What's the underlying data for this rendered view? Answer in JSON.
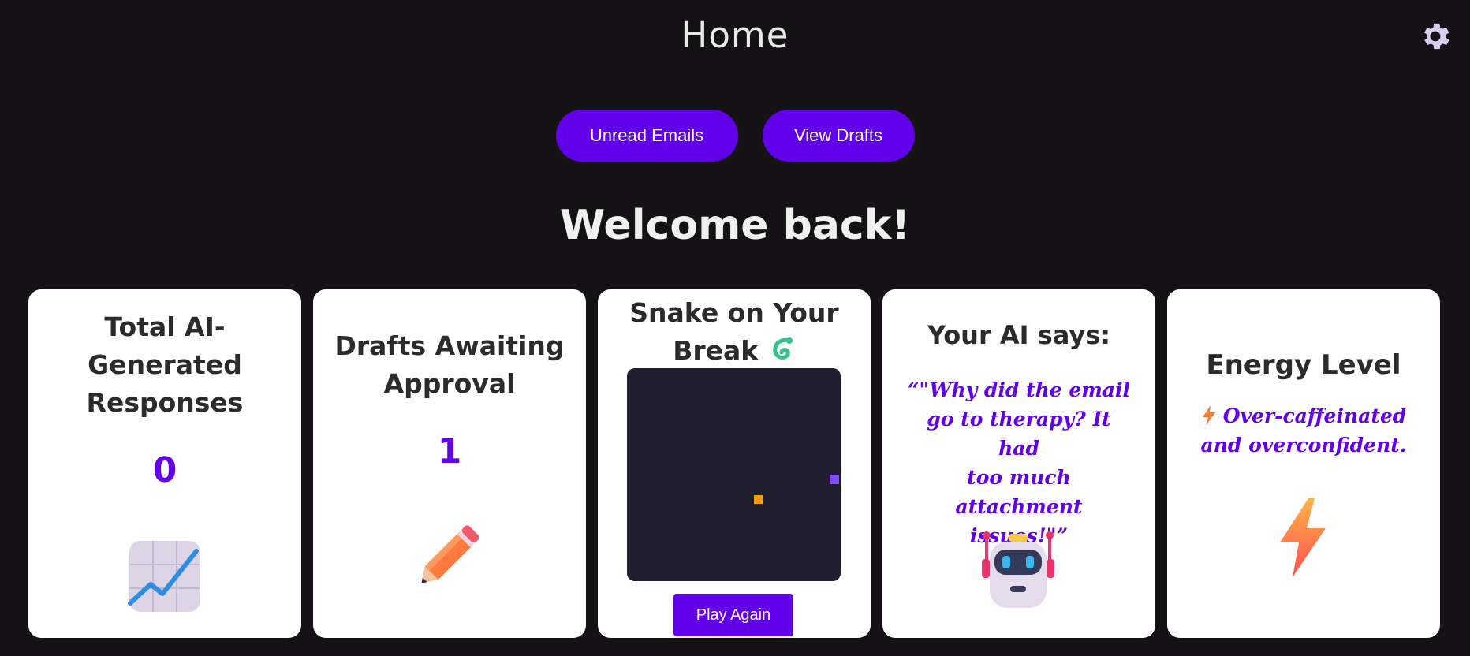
{
  "header": {
    "title": "Home"
  },
  "icons": {
    "settings": "gear-icon"
  },
  "nav": {
    "unread_label": "Unread Emails",
    "drafts_label": "View Drafts"
  },
  "welcome": "Welcome back!",
  "cards": {
    "total": {
      "title_lines": [
        "Total AI-",
        "Generated",
        "Responses"
      ],
      "value": "0",
      "icon": "chart-increasing-icon"
    },
    "drafts": {
      "title_lines": [
        "Drafts Awaiting",
        "Approval"
      ],
      "value": "1",
      "icon": "pencil-icon"
    },
    "snake": {
      "title_lines": [
        "Snake on Your",
        "Break"
      ],
      "icon": "snake-icon",
      "play_label": "Play Again"
    },
    "ai": {
      "title": "Your AI says:",
      "quote_lines": [
        "“\"Why did the email",
        "go to therapy? It had",
        "too much attachment",
        "issues!\"”"
      ],
      "icon": "robot-icon"
    },
    "energy": {
      "title": "Energy Level",
      "status_lines": [
        "Over-caffeinated",
        "and overconfident."
      ],
      "icon": "lightning-icon"
    }
  },
  "colors": {
    "accent": "#6200ea",
    "background": "#141214",
    "game_bg": "#201d2e",
    "food": "#f5a000",
    "snake": "#7c4dff"
  }
}
